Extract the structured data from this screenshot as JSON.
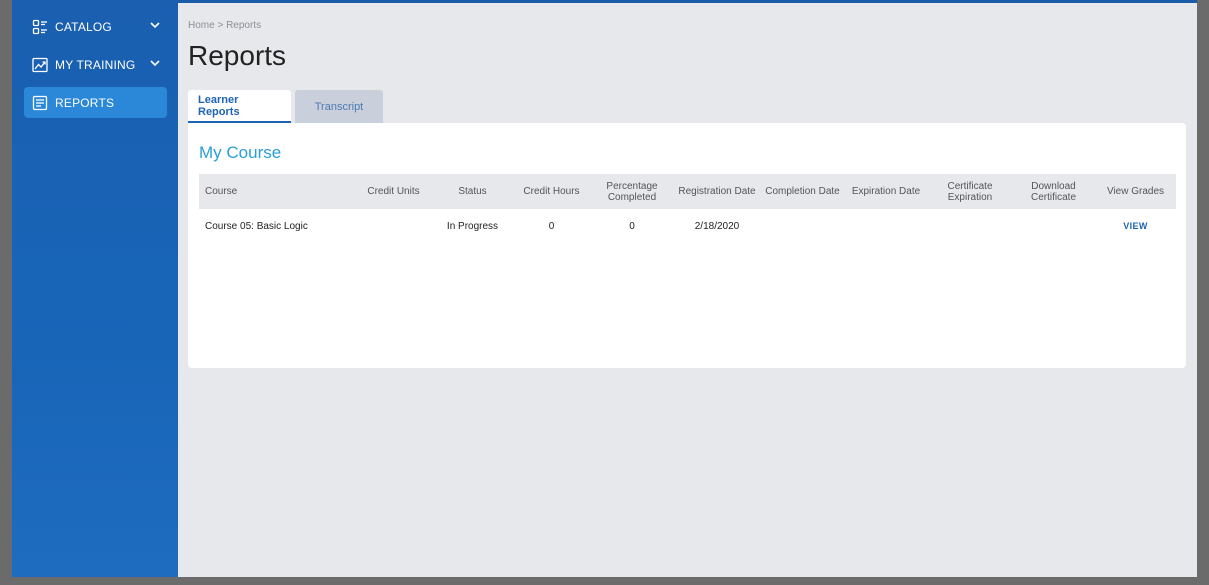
{
  "sidebar": {
    "items": [
      {
        "label": "CATALOG",
        "icon": "catalog-icon",
        "expandable": true
      },
      {
        "label": "MY TRAINING",
        "icon": "chart-line-icon",
        "expandable": true
      },
      {
        "label": "REPORTS",
        "icon": "report-icon",
        "active": true
      }
    ]
  },
  "breadcrumb": "Home > Reports",
  "page_title": "Reports",
  "tabs": [
    {
      "label": "Learner Reports",
      "active": true
    },
    {
      "label": "Transcript",
      "active": false
    }
  ],
  "card": {
    "title": "My Course",
    "columns": [
      "Course",
      "Credit Units",
      "Status",
      "Credit Hours",
      "Percentage Completed",
      "Registration Date",
      "Completion Date",
      "Expiration Date",
      "Certificate Expiration",
      "Download Certificate",
      "View Grades"
    ],
    "rows": [
      {
        "course": "Course 05: Basic Logic",
        "credit_units": "",
        "status": "In Progress",
        "credit_hours": "0",
        "percentage_completed": "0",
        "registration_date": "2/18/2020",
        "completion_date": "",
        "expiration_date": "",
        "certificate_expiration": "",
        "download_certificate": "",
        "view_grades": "VIEW"
      }
    ]
  },
  "colors": {
    "sidebar": "#1a5fb0",
    "active_nav": "#2b88d8",
    "accent_link": "#1e64b4",
    "card_title": "#2a9fd6",
    "page_bg": "#e6e8ec"
  }
}
